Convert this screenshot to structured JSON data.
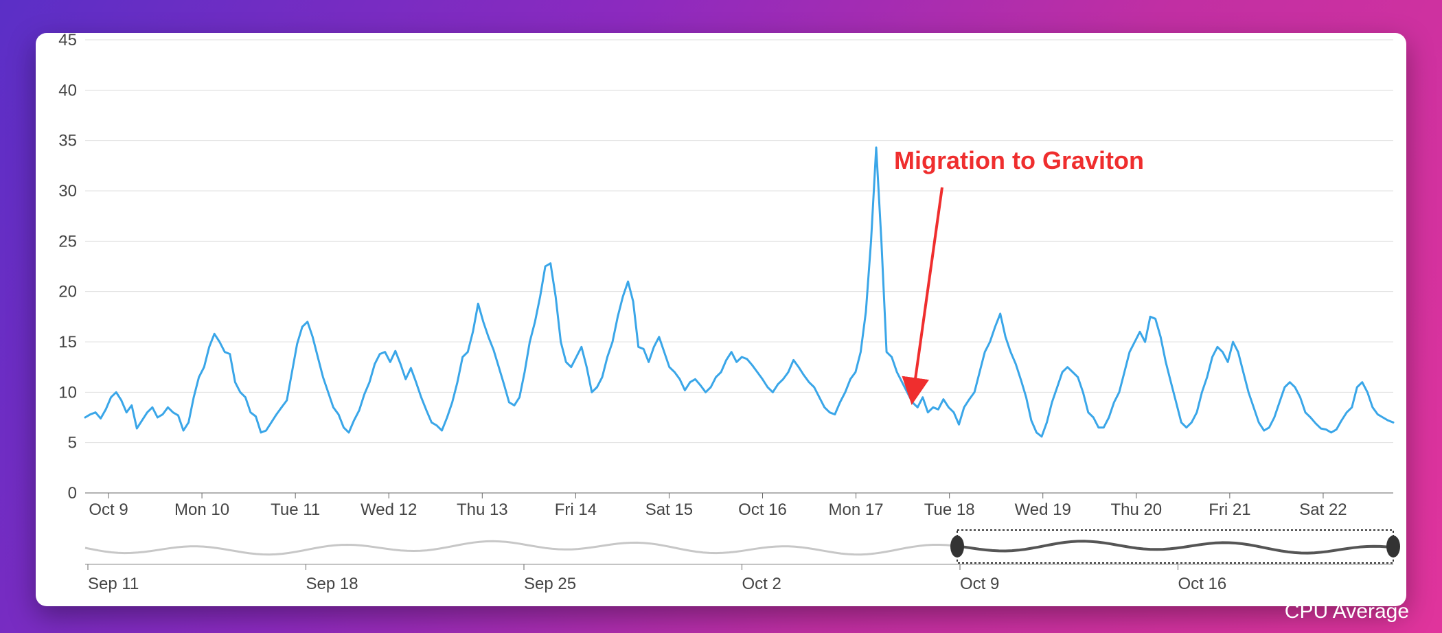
{
  "caption": "CPU Average",
  "annotation_text": "Migration to Graviton",
  "chart_data": {
    "type": "line",
    "title": "",
    "xlabel": "",
    "ylabel": "",
    "ylim": [
      0,
      45
    ],
    "y_ticks": [
      0,
      5,
      10,
      15,
      20,
      25,
      30,
      35,
      40,
      45
    ],
    "x_tick_labels": [
      "Oct 9",
      "Mon 10",
      "Tue 11",
      "Wed 12",
      "Thu 13",
      "Fri 14",
      "Sat 15",
      "Oct 16",
      "Mon 17",
      "Tue 18",
      "Wed 19",
      "Thu 20",
      "Fri 21",
      "Sat 22"
    ],
    "annotation": {
      "text": "Migration to Graviton",
      "at_x_label": "Tue 18",
      "at_y": 9
    },
    "series": [
      {
        "name": "CPU Average",
        "color": "#3aa6e8",
        "values": [
          7.5,
          7.8,
          8.0,
          7.4,
          8.3,
          9.5,
          10.0,
          9.2,
          8.0,
          8.7,
          6.4,
          7.2,
          8.0,
          8.5,
          7.5,
          7.8,
          8.5,
          8.0,
          7.7,
          6.2,
          7.0,
          9.5,
          11.5,
          12.5,
          14.5,
          15.8,
          15.0,
          14.0,
          13.8,
          11.0,
          10.0,
          9.5,
          8.0,
          7.6,
          6.0,
          6.2,
          7.0,
          7.8,
          8.5,
          9.2,
          12.0,
          14.8,
          16.5,
          17.0,
          15.5,
          13.5,
          11.5,
          10.0,
          8.5,
          7.8,
          6.5,
          6.0,
          7.2,
          8.2,
          9.8,
          11.0,
          12.8,
          13.8,
          14.0,
          13.0,
          14.1,
          12.8,
          11.3,
          12.4,
          11.0,
          9.5,
          8.2,
          7.0,
          6.7,
          6.2,
          7.5,
          9.0,
          11.0,
          13.5,
          14.0,
          16.0,
          18.8,
          17.0,
          15.5,
          14.2,
          12.5,
          10.8,
          9.0,
          8.7,
          9.5,
          12.0,
          15.0,
          17.0,
          19.5,
          22.5,
          22.8,
          19.5,
          15.0,
          13.0,
          12.5,
          13.5,
          14.5,
          12.5,
          10.0,
          10.5,
          11.5,
          13.5,
          15.0,
          17.5,
          19.5,
          21.0,
          19.0,
          14.5,
          14.3,
          13.0,
          14.5,
          15.5,
          14.0,
          12.5,
          12.0,
          11.3,
          10.2,
          11.0,
          11.3,
          10.7,
          10.0,
          10.5,
          11.5,
          12.0,
          13.2,
          14.0,
          13.0,
          13.5,
          13.3,
          12.7,
          12.0,
          11.3,
          10.5,
          10.0,
          10.8,
          11.3,
          12.0,
          13.2,
          12.5,
          11.7,
          11.0,
          10.5,
          9.5,
          8.5,
          8.0,
          7.8,
          9.0,
          10.0,
          11.3,
          12.0,
          14.0,
          18.0,
          25.0,
          34.3,
          25.0,
          14.0,
          13.5,
          12.0,
          11.0,
          10.0,
          9.0,
          8.5,
          9.5,
          8.0,
          8.5,
          8.3,
          9.3,
          8.5,
          8.0,
          6.8,
          8.5,
          9.3,
          10.0,
          12.0,
          14.0,
          15.0,
          16.5,
          17.8,
          15.5,
          14.0,
          12.8,
          11.2,
          9.5,
          7.2,
          6.0,
          5.6,
          7.0,
          9.0,
          10.5,
          12.0,
          12.5,
          12.0,
          11.5,
          10.0,
          8.0,
          7.5,
          6.5,
          6.5,
          7.5,
          9.0,
          10.0,
          12.0,
          14.0,
          15.0,
          16.0,
          15.0,
          17.5,
          17.3,
          15.5,
          13.0,
          11.0,
          9.0,
          7.0,
          6.5,
          7.0,
          8.0,
          10.0,
          11.5,
          13.5,
          14.5,
          14.0,
          13.0,
          15.0,
          14.0,
          12.0,
          10.0,
          8.5,
          7.0,
          6.2,
          6.5,
          7.5,
          9.0,
          10.5,
          11.0,
          10.5,
          9.5,
          8.0,
          7.5,
          6.9,
          6.4,
          6.3,
          6.0,
          6.3,
          7.2,
          8.0,
          8.5,
          10.5,
          11.0,
          10.0,
          8.5,
          7.8,
          7.5,
          7.2,
          7.0
        ]
      }
    ],
    "brush": {
      "overview_x_tick_labels": [
        "Sep 11",
        "Sep 18",
        "Sep 25",
        "Oct 2",
        "Oct 9",
        "Oct 16"
      ],
      "selection_labels": [
        "Oct 9",
        "Oct 22"
      ]
    }
  }
}
